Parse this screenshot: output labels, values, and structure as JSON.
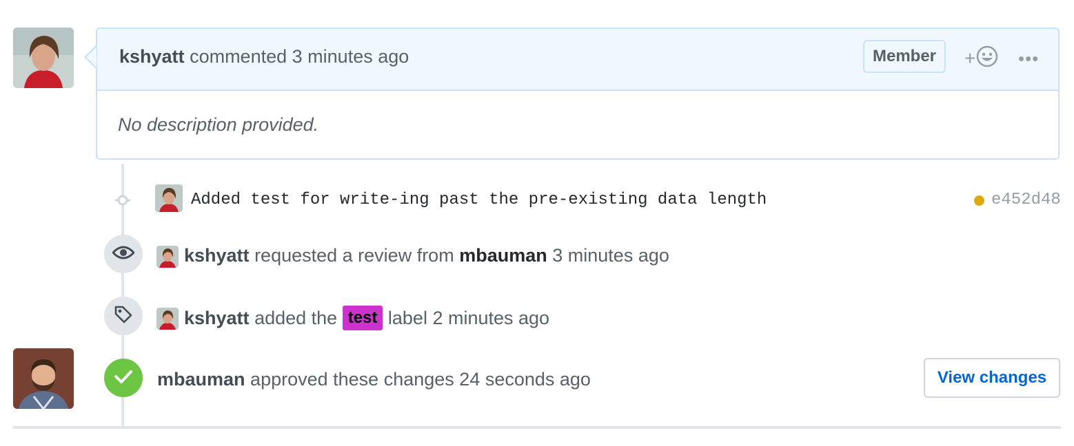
{
  "comment": {
    "author": "kshyatt",
    "action": "commented",
    "time": "3 minutes ago",
    "role_badge": "Member",
    "reaction_plus": "+",
    "more_label": "•••",
    "body": "No description provided."
  },
  "commit": {
    "message": "Added test for write-ing past the pre-existing data length",
    "sha": "e452d48",
    "status_color": "#dbab09"
  },
  "review_request": {
    "actor": "kshyatt",
    "action": "requested a review from",
    "reviewer": "mbauman",
    "time": "3 minutes ago"
  },
  "label_event": {
    "actor": "kshyatt",
    "action": "added the",
    "label": "test",
    "label_color": "#cc33cc",
    "suffix": "label",
    "time": "2 minutes ago"
  },
  "approval": {
    "actor": "mbauman",
    "action": "approved these changes",
    "time": "24 seconds ago",
    "button_label": "View changes"
  },
  "icons": {
    "review": "eye-icon",
    "label": "tag-icon",
    "approval": "check-icon",
    "commit": "git-commit-icon",
    "reaction": "smiley-icon",
    "more": "kebab-horizontal-icon"
  }
}
